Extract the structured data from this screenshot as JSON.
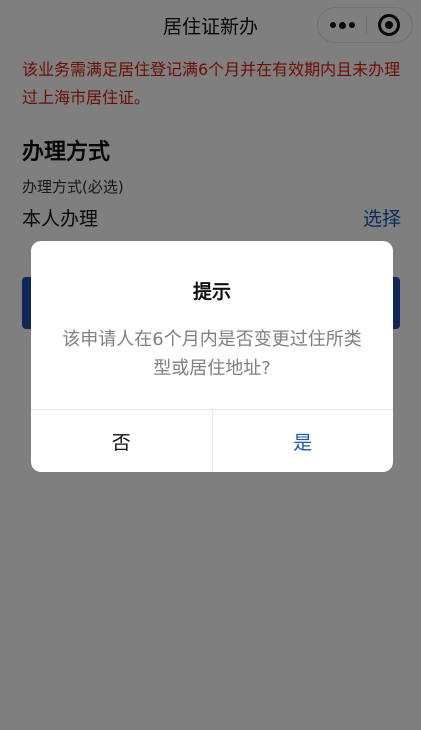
{
  "navbar": {
    "title": "居住证新办",
    "more_icon": "more-dots-icon",
    "close_icon": "target-close-icon"
  },
  "main": {
    "notice": "该业务需满足居住登记满6个月并在有效期内且未办理过上海市居住证。",
    "section_title": "办理方式",
    "field_label": "办理方式(必选)",
    "field_value": "本人办理",
    "select_link": "选择"
  },
  "dialog": {
    "title": "提示",
    "message": "该申请人在6个月内是否变更过住所类型或居住地址?",
    "cancel_label": "否",
    "confirm_label": "是"
  },
  "colors": {
    "notice_red": "#d81e06",
    "accent_blue": "#1a55b6",
    "button_blue": "#1f4fb6",
    "mask": "rgba(0,0,0,0.5)"
  }
}
